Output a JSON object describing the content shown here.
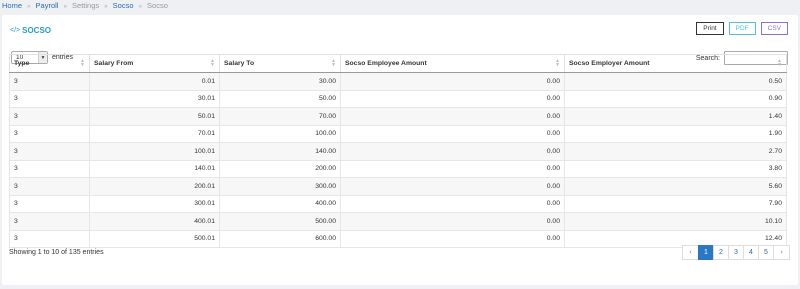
{
  "breadcrumb": [
    {
      "label": "Home",
      "link": true
    },
    {
      "label": "Payroll",
      "link": true
    },
    {
      "label": "Settings",
      "link": false
    },
    {
      "label": "Socso",
      "link": true
    },
    {
      "label": "Socso",
      "link": false
    }
  ],
  "card": {
    "title": "SOCSO",
    "title_icon": "</>"
  },
  "export": {
    "print": "Print",
    "pdf": "PDF",
    "csv": "CSV"
  },
  "length": {
    "value": "10",
    "label": "entries"
  },
  "search": {
    "label": "Search:",
    "placeholder": ""
  },
  "table": {
    "columns": [
      "Type",
      "Salary From",
      "Salary To",
      "Socso Employee Amount",
      "Socso Employer Amount"
    ],
    "rows": [
      [
        "3",
        "0.01",
        "30.00",
        "0.00",
        "0.50"
      ],
      [
        "3",
        "30.01",
        "50.00",
        "0.00",
        "0.90"
      ],
      [
        "3",
        "50.01",
        "70.00",
        "0.00",
        "1.40"
      ],
      [
        "3",
        "70.01",
        "100.00",
        "0.00",
        "1.90"
      ],
      [
        "3",
        "100.01",
        "140.00",
        "0.00",
        "2.70"
      ],
      [
        "3",
        "140.01",
        "200.00",
        "0.00",
        "3.80"
      ],
      [
        "3",
        "200.01",
        "300.00",
        "0.00",
        "5.60"
      ],
      [
        "3",
        "300.01",
        "400.00",
        "0.00",
        "7.90"
      ],
      [
        "3",
        "400.01",
        "500.00",
        "0.00",
        "10.10"
      ],
      [
        "3",
        "500.01",
        "600.00",
        "0.00",
        "12.40"
      ]
    ]
  },
  "info": "Showing 1 to 10 of 135 entries",
  "pagination": {
    "prev": "‹",
    "next": "›",
    "pages": [
      "1",
      "2",
      "3",
      "4",
      "5"
    ],
    "active": "1"
  }
}
